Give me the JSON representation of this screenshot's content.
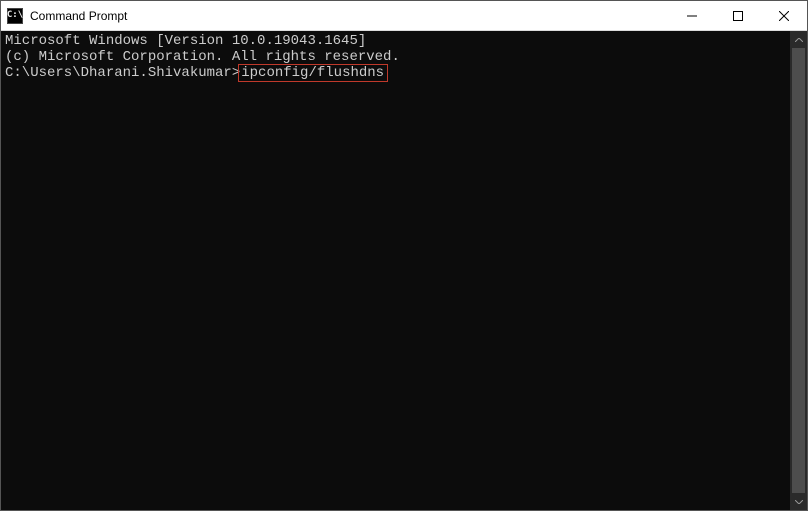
{
  "titlebar": {
    "icon_text": "C:\\",
    "title": "Command Prompt"
  },
  "terminal": {
    "line1": "Microsoft Windows [Version 10.0.19043.1645]",
    "line2": "(c) Microsoft Corporation. All rights reserved.",
    "blank": "",
    "prompt": "C:\\Users\\Dharani.Shivakumar>",
    "command": "ipconfig/flushdns"
  },
  "colors": {
    "terminal_bg": "#0c0c0c",
    "terminal_fg": "#cccccc",
    "highlight_border": "#c0392b"
  }
}
